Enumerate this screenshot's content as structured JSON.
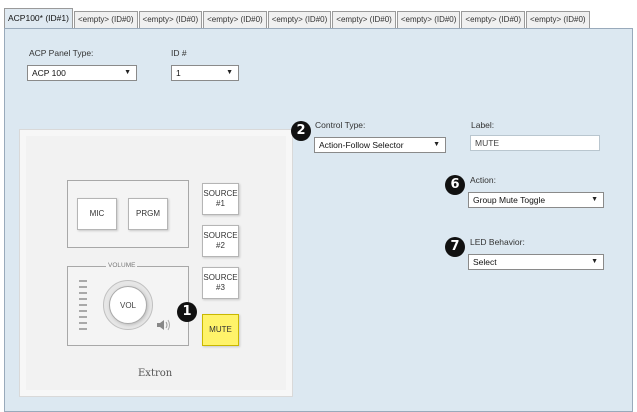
{
  "tabs": [
    {
      "label": "ACP100* (ID#1)",
      "active": true
    },
    {
      "label": "<empty> (ID#0)"
    },
    {
      "label": "<empty> (ID#0)"
    },
    {
      "label": "<empty> (ID#0)"
    },
    {
      "label": "<empty> (ID#0)"
    },
    {
      "label": "<empty> (ID#0)"
    },
    {
      "label": "<empty> (ID#0)"
    },
    {
      "label": "<empty> (ID#0)"
    },
    {
      "label": "<empty> (ID#0)"
    }
  ],
  "panel_type": {
    "label": "ACP Panel Type:",
    "value": "ACP 100"
  },
  "id_field": {
    "label": "ID #",
    "value": "1"
  },
  "control_type": {
    "label": "Control Type:",
    "value": "Action-Follow Selector",
    "badge": "2"
  },
  "label_field": {
    "label": "Label:",
    "value": "MUTE"
  },
  "action": {
    "label": "Action:",
    "value": "Group Mute Toggle",
    "badge": "6"
  },
  "led_behavior": {
    "label": "LED Behavior:",
    "value": "Select",
    "badge": "7"
  },
  "device": {
    "buttons": {
      "mic": "MIC",
      "prgm": "PRGM",
      "source1": "SOURCE\n#1",
      "source2": "SOURCE\n#2",
      "source3": "SOURCE\n#3",
      "mute": "MUTE"
    },
    "volume_label": "VOLUME",
    "knob_label": "VOL",
    "brand": "Extron",
    "selected_badge": "1",
    "mute_color": "#fff36a"
  }
}
